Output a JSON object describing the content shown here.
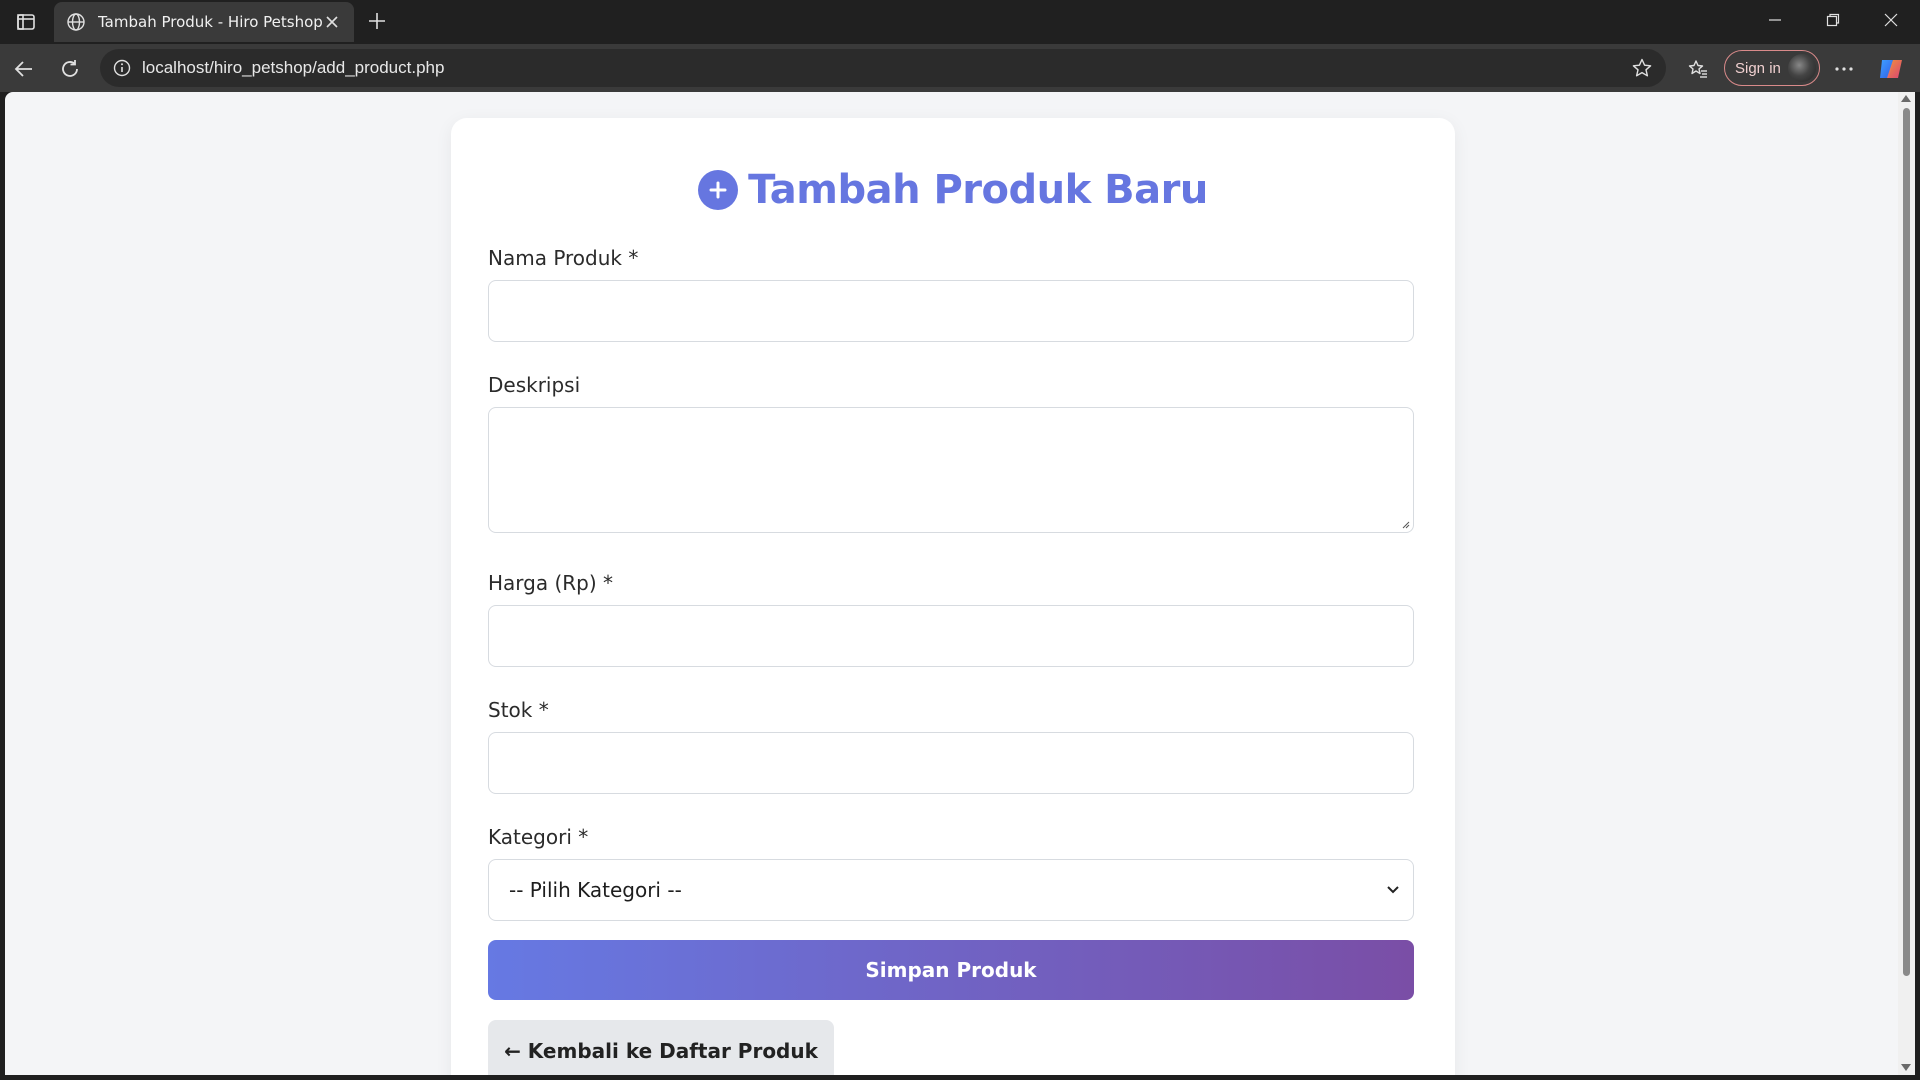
{
  "browser": {
    "tab_title": "Tambah Produk - Hiro Petshop",
    "url": "localhost/hiro_petshop/add_product.php",
    "signin_label": "Sign in"
  },
  "form": {
    "heading": "Tambah Produk Baru",
    "fields": {
      "name_label": "Nama Produk *",
      "name_value": "",
      "description_label": "Deskripsi",
      "description_value": "",
      "price_label": "Harga (Rp) *",
      "price_value": "",
      "stock_label": "Stok *",
      "stock_value": "",
      "category_label": "Kategori *",
      "category_selected": "-- Pilih Kategori --"
    },
    "save_label": "Simpan Produk",
    "back_label": "← Kembali ke Daftar Produk"
  },
  "colors": {
    "accent": "#6676e0",
    "button_gradient_start": "#6679e3",
    "button_gradient_end": "#7a4ea6"
  }
}
